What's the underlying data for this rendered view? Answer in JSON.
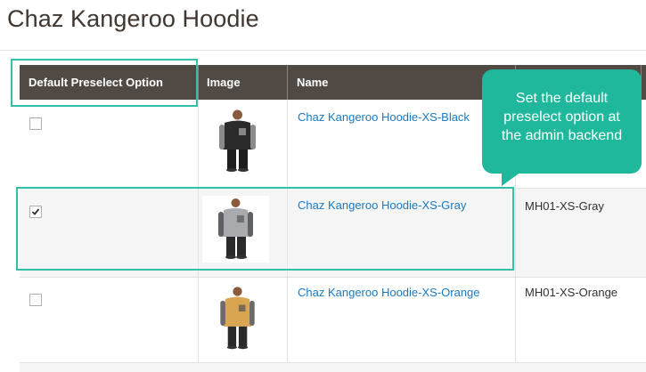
{
  "page": {
    "title": "Chaz Kangeroo Hoodie"
  },
  "grid": {
    "columns": [
      "Default Preselect Option",
      "Image",
      "Name",
      ""
    ],
    "rows": [
      {
        "checked": false,
        "name": "Chaz Kangeroo Hoodie-XS-Black",
        "sku": "",
        "image": "black-hoodie-model",
        "hoodie_color": "#2b2b2b"
      },
      {
        "checked": true,
        "name": "Chaz Kangeroo Hoodie-XS-Gray",
        "sku": "MH01-XS-Gray",
        "image": "gray-hoodie-model",
        "hoodie_color": "#a9aaad"
      },
      {
        "checked": false,
        "name": "Chaz Kangeroo Hoodie-XS-Orange",
        "sku": "MH01-XS-Orange",
        "image": "orange-hoodie-model",
        "hoodie_color": "#d9a550"
      }
    ]
  },
  "callout": {
    "lines": [
      "Set the default",
      "preselect option at",
      "the admin backend"
    ],
    "color": "#1fb89d"
  },
  "colors": {
    "header_bg": "#514943",
    "link": "#1979c3",
    "highlight": "#2fc0a6"
  }
}
